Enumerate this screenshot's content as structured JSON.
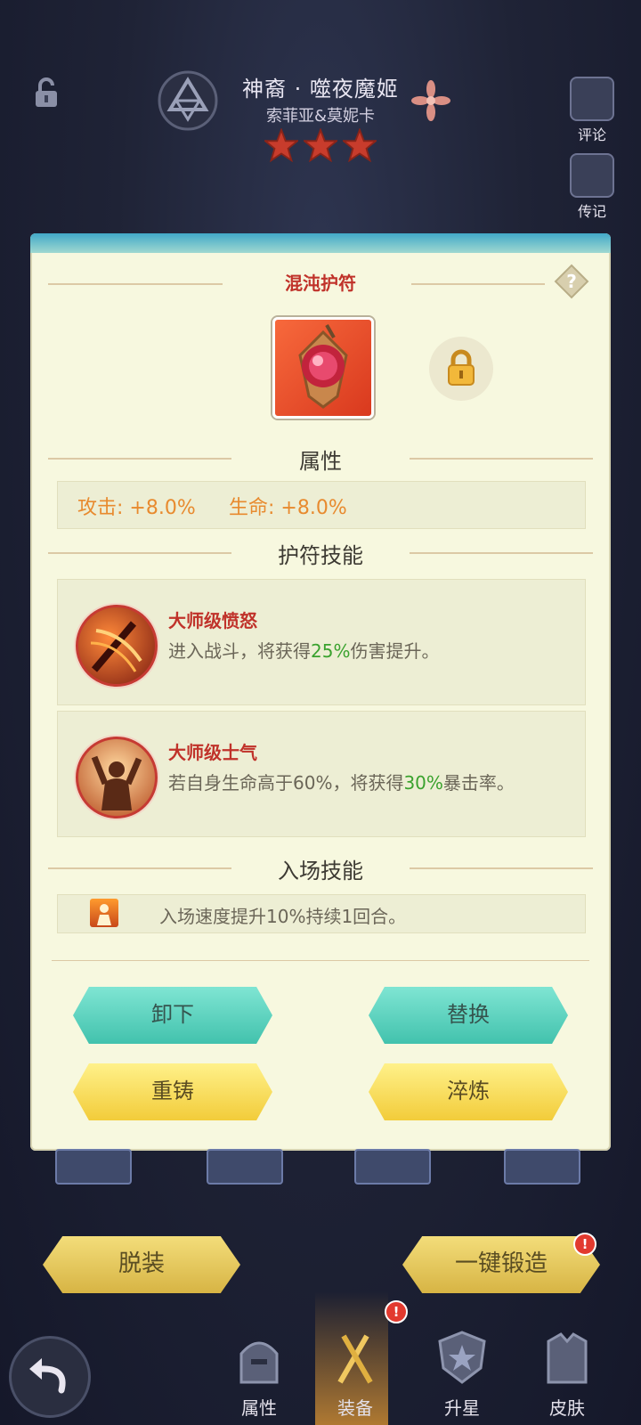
{
  "hero": {
    "title": "神裔 · 噬夜魔姬",
    "subtitle": "索菲亚&莫妮卡",
    "stars": 3
  },
  "side_buttons": [
    {
      "label": "评论",
      "icon": "comment-book-icon"
    },
    {
      "label": "传记",
      "icon": "biography-book-icon"
    }
  ],
  "panel": {
    "item_name": "混沌护符",
    "attributes_title": "属性",
    "attributes": {
      "attack_label": "攻击: +8.0%",
      "hp_label": "生命: +8.0%"
    },
    "amulet_skills_title": "护符技能",
    "skills": [
      {
        "name": "大师级愤怒",
        "desc_pre": "进入战斗，将获得",
        "desc_hl": "25%",
        "desc_post": "伤害提升。",
        "icon": "sword-slash-icon"
      },
      {
        "name": "大师级士气",
        "desc_pre": "若自身生命高于60%，将获得",
        "desc_hl": "30%",
        "desc_post": "暴击率。",
        "icon": "warrior-cheer-icon"
      }
    ],
    "entry_skill_title": "入场技能",
    "entry_skill_desc": "入场速度提升10%持续1回合。",
    "buttons": {
      "unequip": "卸下",
      "replace": "替换",
      "reforge": "重铸",
      "refine": "淬炼"
    }
  },
  "bottom": {
    "unequip_all": "脱装",
    "one_click_forge": "一键锻造",
    "badge": "!"
  },
  "tabs": [
    {
      "label": "属性",
      "icon": "helmet-icon",
      "active": false
    },
    {
      "label": "装备",
      "icon": "weapons-icon",
      "active": true,
      "badge": "!"
    },
    {
      "label": "升星",
      "icon": "star-shield-icon",
      "active": false
    },
    {
      "label": "皮肤",
      "icon": "armor-icon",
      "active": false
    }
  ],
  "colors": {
    "panel_bg": "#f7f8df",
    "skill_name": "#c0322a",
    "highlight_green": "#3aa22e",
    "attr_orange": "#e88a2e",
    "teal_button": "#42c2ad",
    "yellow_button": "#f2cc3a"
  }
}
